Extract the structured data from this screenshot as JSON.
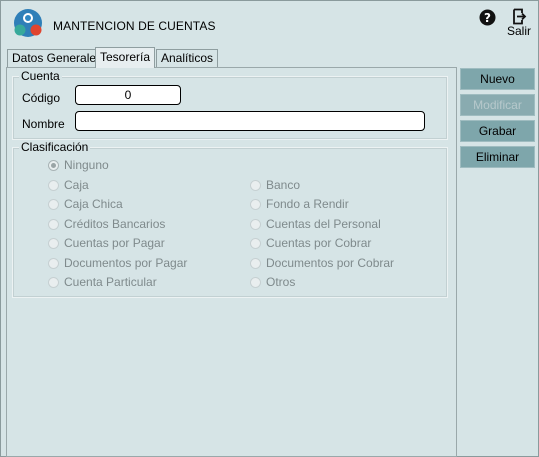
{
  "header": {
    "title": "MANTENCION DE CUENTAS",
    "exit_label": "Salir"
  },
  "tabs": [
    {
      "label": "Datos Generales",
      "active": false
    },
    {
      "label": "Tesorería",
      "active": true
    },
    {
      "label": "Analíticos",
      "active": false
    }
  ],
  "cuenta": {
    "legend": "Cuenta",
    "codigo_label": "Código",
    "codigo_value": "0",
    "nombre_label": "Nombre",
    "nombre_value": ""
  },
  "clasificacion": {
    "legend": "Clasificación",
    "options": [
      {
        "label": "Ninguno",
        "checked": true
      },
      {
        "label": "Caja",
        "checked": false
      },
      {
        "label": "Banco",
        "checked": false
      },
      {
        "label": "Caja Chica",
        "checked": false
      },
      {
        "label": "Fondo a Rendir",
        "checked": false
      },
      {
        "label": "Créditos Bancarios",
        "checked": false
      },
      {
        "label": "Cuentas del Personal",
        "checked": false
      },
      {
        "label": "Cuentas por Pagar",
        "checked": false
      },
      {
        "label": "Cuentas por Cobrar",
        "checked": false
      },
      {
        "label": "Documentos por Pagar",
        "checked": false
      },
      {
        "label": "Documentos por Cobrar",
        "checked": false
      },
      {
        "label": "Cuenta Particular",
        "checked": false
      },
      {
        "label": "Otros",
        "checked": false
      }
    ]
  },
  "actions": {
    "nuevo": "Nuevo",
    "modificar": "Modificar",
    "grabar": "Grabar",
    "eliminar": "Eliminar"
  },
  "colors": {
    "background": "#d6e4e6",
    "button": "#7ea6ab",
    "logo_red": "#e0442f",
    "logo_blue": "#2f86c2",
    "logo_teal": "#37a99b"
  },
  "icons": [
    "app-logo-icon",
    "help-icon",
    "exit-door-icon"
  ]
}
